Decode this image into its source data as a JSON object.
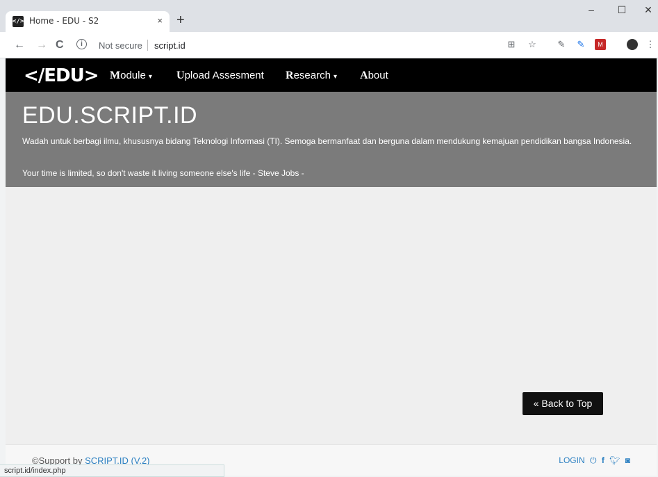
{
  "browser": {
    "tab_title": "Home - EDU - S2",
    "tab_favicon_text": "</>",
    "tab_close": "×",
    "new_tab": "+",
    "window_minimize": "–",
    "window_maximize": "☐",
    "window_close": "✕",
    "nav_back": "←",
    "nav_forward": "→",
    "nav_reload": "C",
    "security_label": "Not secure",
    "url": "script.id",
    "status_url": "script.id/index.php"
  },
  "navbar": {
    "logo": "</EDU>",
    "menu": [
      {
        "initial": "M",
        "rest": "odule",
        "dropdown": true
      },
      {
        "initial": "U",
        "rest": "pload Assesment",
        "dropdown": false
      },
      {
        "initial": "R",
        "rest": "esearch",
        "dropdown": true
      },
      {
        "initial": "A",
        "rest": "bout",
        "dropdown": false
      }
    ],
    "caret": "▾"
  },
  "hero": {
    "title": "EDU.SCRIPT.ID",
    "description": "Wadah untuk berbagi ilmu, khususnya bidang Teknologi Informasi (TI). Semoga bermanfaat dan berguna dalam mendukung kemajuan pendidikan bangsa Indonesia.",
    "quote": "Your time is limited, so don't waste it living someone else's life - Steve Jobs -"
  },
  "back_to_top": "« Back to Top",
  "footer": {
    "copyright_prefix": "©Support by ",
    "link_text": "SCRIPT.ID (V.2)",
    "login": "LOGIN",
    "icons": [
      "power-icon",
      "facebook-icon",
      "twitter-icon",
      "instagram-icon"
    ]
  },
  "colors": {
    "navbar_bg": "#000000",
    "hero_bg": "#7b7b7b",
    "page_bg": "#efefef",
    "link": "#2a7fc1"
  }
}
